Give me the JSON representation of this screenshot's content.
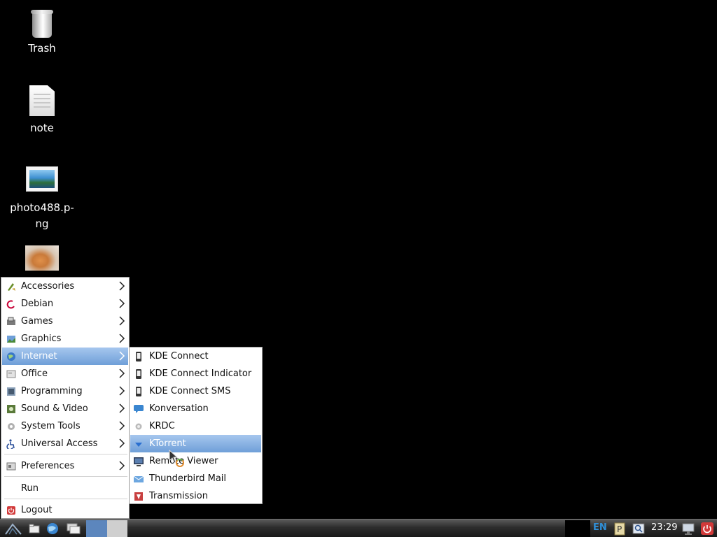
{
  "desktop": {
    "icons": [
      {
        "label": "Trash",
        "icon": "trash-icon"
      },
      {
        "label": "note",
        "icon": "text-file-icon"
      },
      {
        "label": "photo488.p-ng",
        "icon": "image-file-icon"
      },
      {
        "label": "",
        "icon": "cat-photo-thumbnail"
      }
    ]
  },
  "menu": {
    "items": [
      {
        "label": "Accessories",
        "icon": "accessories-icon",
        "submenu": true
      },
      {
        "label": "Debian",
        "icon": "debian-icon",
        "submenu": true
      },
      {
        "label": "Games",
        "icon": "games-icon",
        "submenu": true
      },
      {
        "label": "Graphics",
        "icon": "graphics-icon",
        "submenu": true
      },
      {
        "label": "Internet",
        "icon": "internet-icon",
        "submenu": true,
        "active": true
      },
      {
        "label": "Office",
        "icon": "office-icon",
        "submenu": true
      },
      {
        "label": "Programming",
        "icon": "programming-icon",
        "submenu": true
      },
      {
        "label": "Sound & Video",
        "icon": "sound-video-icon",
        "submenu": true
      },
      {
        "label": "System Tools",
        "icon": "system-tools-icon",
        "submenu": true
      },
      {
        "label": "Universal Access",
        "icon": "accessibility-icon",
        "submenu": true
      },
      {
        "label": "Preferences",
        "icon": "preferences-icon",
        "submenu": true
      },
      {
        "label": "Run",
        "icon": "",
        "submenu": false
      },
      {
        "label": "Logout",
        "icon": "logout-icon",
        "submenu": false
      }
    ]
  },
  "submenu": {
    "parent": "Internet",
    "items": [
      {
        "label": "KDE Connect",
        "icon": "kde-connect-icon"
      },
      {
        "label": "KDE Connect Indicator",
        "icon": "kde-connect-icon"
      },
      {
        "label": "KDE Connect SMS",
        "icon": "kde-connect-icon"
      },
      {
        "label": "Konversation",
        "icon": "chat-icon"
      },
      {
        "label": "KRDC",
        "icon": "krdc-icon"
      },
      {
        "label": "KTorrent",
        "icon": "ktorrent-icon",
        "active": true
      },
      {
        "label": "Remote Viewer",
        "icon": "monitor-icon"
      },
      {
        "label": "Thunderbird Mail",
        "icon": "mail-icon"
      },
      {
        "label": "Transmission",
        "icon": "transmission-icon"
      }
    ]
  },
  "taskbar": {
    "launchers": [
      "menu-logo-icon",
      "file-manager-icon",
      "web-browser-icon",
      "window-switch-icon"
    ],
    "language": "EN",
    "clock": "23:29",
    "tray": [
      "keyboard-layout-icon",
      "clipboard-icon",
      "screenshot-icon",
      "network-icon",
      "power-icon"
    ]
  },
  "colors": {
    "desktop_bg": "#000000",
    "menu_highlight": "#6f9fd8",
    "taskbar_bg": "#2d2d2d",
    "lang_text": "#2f8fd8"
  }
}
